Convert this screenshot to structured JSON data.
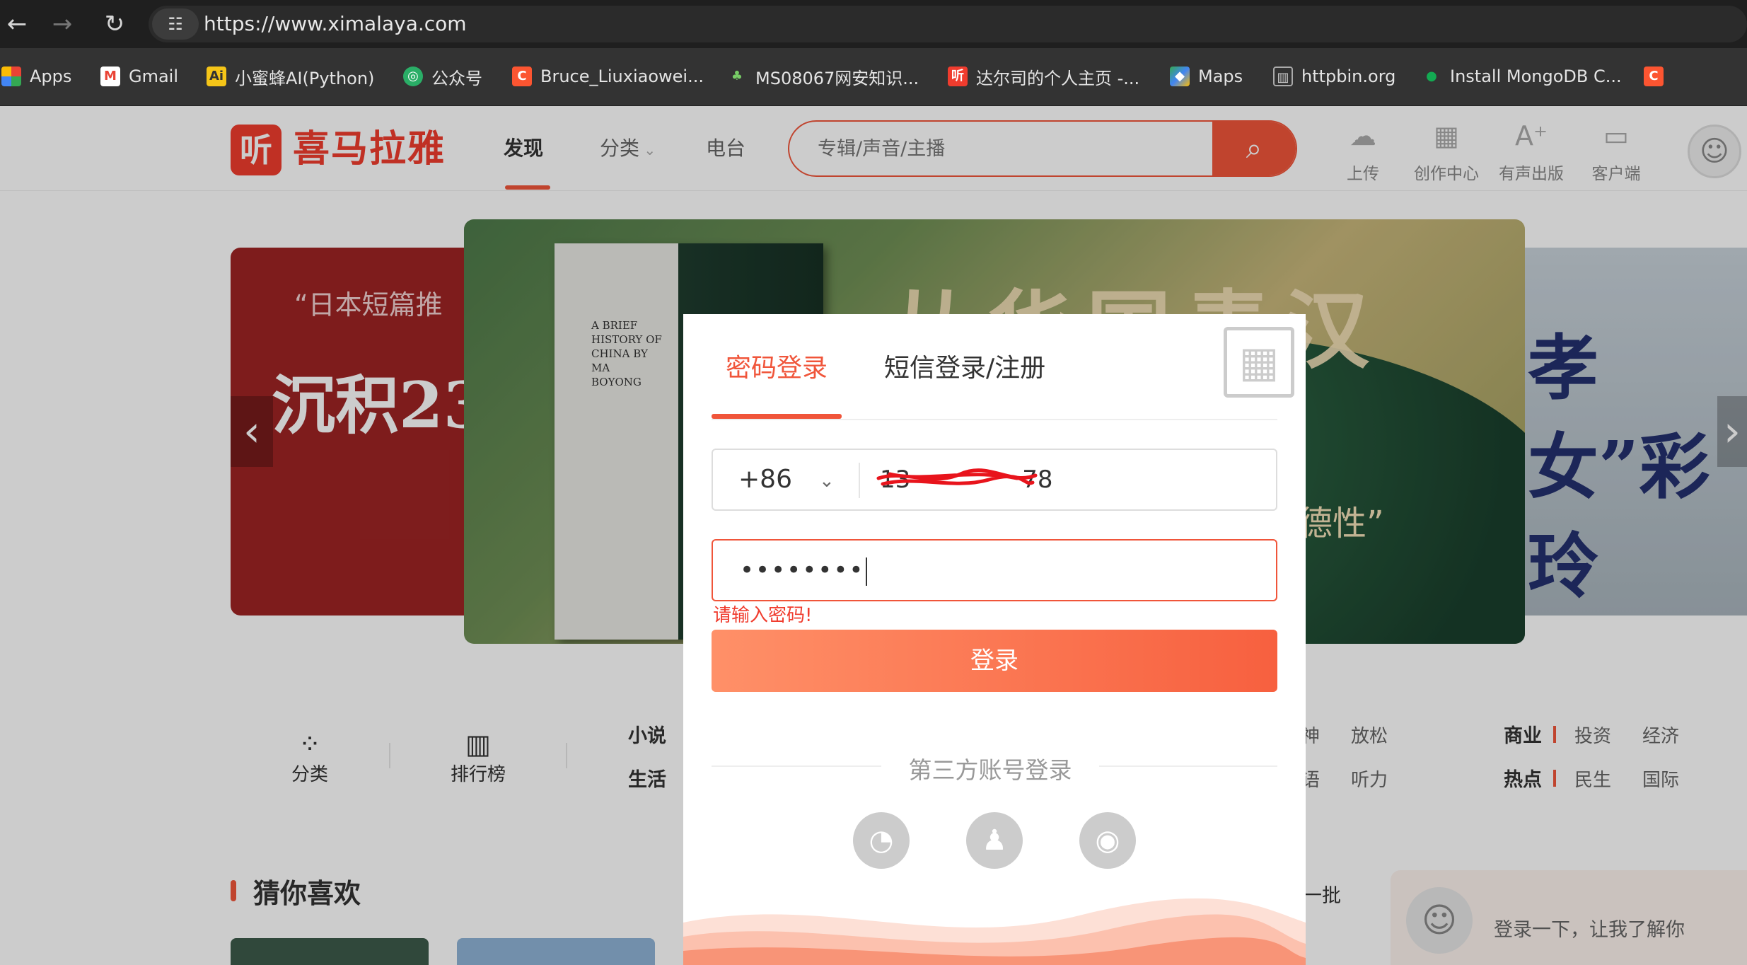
{
  "browser": {
    "url": "https://www.ximalaya.com",
    "bookmarks": [
      {
        "label": "Apps",
        "icon": "apps-grid-icon"
      },
      {
        "label": "Gmail",
        "icon": "gmail-icon"
      },
      {
        "label": "小蜜蜂AI(Python)",
        "icon": "ai-icon"
      },
      {
        "label": "公众号",
        "icon": "wechat-leaf-icon"
      },
      {
        "label": "Bruce_Liuxiaowei...",
        "icon": "csdn-icon"
      },
      {
        "label": "MS08067网安知识...",
        "icon": "plant-icon"
      },
      {
        "label": "达尔司的个人主页 -...",
        "icon": "ximalaya-icon"
      },
      {
        "label": "Maps",
        "icon": "maps-icon"
      },
      {
        "label": "httpbin.org",
        "icon": "trash-icon"
      },
      {
        "label": "Install MongoDB C...",
        "icon": "mongodb-icon"
      }
    ]
  },
  "site": {
    "logo_glyph": "听",
    "logo_text": "喜马拉雅",
    "nav": [
      "发现",
      "分类",
      "电台"
    ],
    "search_placeholder": "专辑/声音/主播",
    "tools": [
      "上传",
      "创作中心",
      "有声出版",
      "客户端"
    ]
  },
  "banner": {
    "left_tag": "“日本短篇推",
    "left_title": "沉积23",
    "book_title_en": "A BRIEF HISTORY OF CHINA BY MA BOYONG",
    "main_title": "从华国青汉",
    "main_title2": "国",
    "main_sub": "德性”",
    "right_text": "孝女”彩玲"
  },
  "categories": {
    "icon_items": [
      "分类",
      "排行榜"
    ],
    "col1": [
      "小说",
      "生活"
    ],
    "col_mid": [
      "神",
      "语"
    ],
    "col_mid2": [
      "放松",
      "听力"
    ],
    "bold": [
      "商业",
      "热点"
    ],
    "col4": [
      "投资",
      "民生"
    ],
    "col5": [
      "经济",
      "国际"
    ]
  },
  "guess": {
    "title": "猜你喜欢",
    "more": "一批"
  },
  "login_hint": "登录一下，让我了解你",
  "modal": {
    "tab_password": "密码登录",
    "tab_sms": "短信登录/注册",
    "country_code": "+86",
    "phone_value": "13",
    "phone_tail": "78",
    "password_value": "••••••••",
    "error": "请输入密码!",
    "login_button": "登录",
    "third_party": "第三方账号登录",
    "social": [
      "wechat-icon",
      "qq-icon",
      "weibo-icon"
    ]
  },
  "colors": {
    "accent": "#f0553a",
    "error": "#f03c2e"
  }
}
